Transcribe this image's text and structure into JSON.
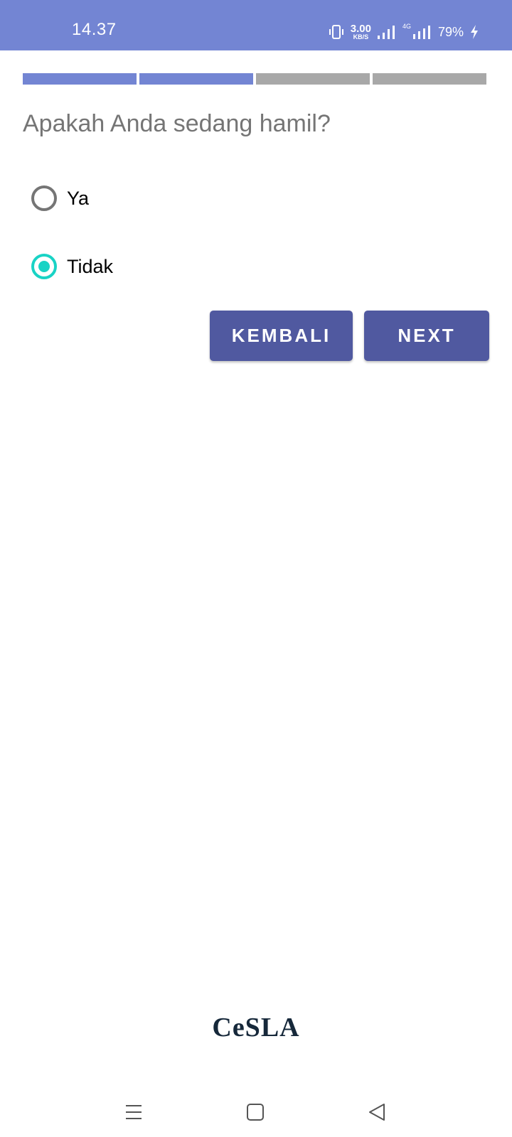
{
  "status_bar": {
    "time": "14.37",
    "speed_value": "3.00",
    "speed_unit": "KB/S",
    "network_type": "4G",
    "battery": "79%",
    "icons": [
      "vibrate-icon",
      "signal-icon",
      "signal-4g-icon",
      "charging-icon"
    ]
  },
  "progress": {
    "total_steps": 4,
    "completed_steps": 2
  },
  "question": "Apakah Anda sedang hamil?",
  "options": [
    {
      "label": "Ya",
      "selected": false
    },
    {
      "label": "Tidak",
      "selected": true
    }
  ],
  "buttons": {
    "back_label": "KEMBALI",
    "next_label": "NEXT"
  },
  "logo_text": "CeSLA",
  "nav_bar": {
    "icons": [
      "menu-icon",
      "home-icon",
      "back-icon"
    ]
  },
  "colors": {
    "primary": "#7385d3",
    "button": "#5059a0",
    "radio_selected": "#19d3c5",
    "progress_inactive": "#a8a8a8"
  }
}
